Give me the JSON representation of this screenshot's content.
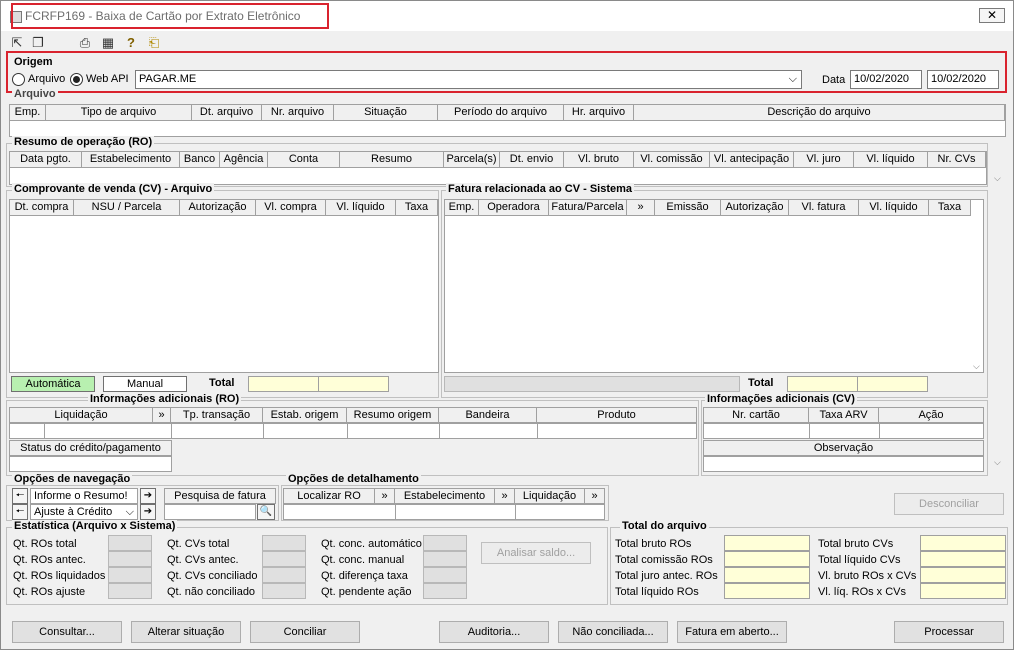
{
  "window": {
    "title": "FCRFP169 - Baixa de Cartão por Extrato Eletrônico",
    "close_label": "✕"
  },
  "toolbar": {
    "icons": [
      "arrow-in-icon",
      "windows-icon",
      "print-icon",
      "calendar-icon",
      "help-icon",
      "exit-icon"
    ]
  },
  "origem": {
    "label": "Origem",
    "opt1": "Arquivo",
    "opt2": "Web API",
    "selected": "Web API",
    "provider": "PAGAR.ME",
    "data_label": "Data",
    "date_from": "10/02/2020",
    "date_to": "10/02/2020"
  },
  "arquivo": {
    "label": "Arquivo",
    "cols": [
      "Emp.",
      "Tipo de arquivo",
      "Dt. arquivo",
      "Nr. arquivo",
      "Situação",
      "Período do arquivo",
      "Hr. arquivo",
      "Descrição do arquivo"
    ]
  },
  "ro": {
    "label": "Resumo de operação (RO)",
    "cols": [
      "Data pgto.",
      "Estabelecimento",
      "Banco",
      "Agência",
      "Conta",
      "Resumo",
      "Parcela(s)",
      "Dt. envio",
      "Vl. bruto",
      "Vl. comissão",
      "Vl. antecipação",
      "Vl. juro",
      "Vl. líquido",
      "Nr. CVs"
    ]
  },
  "cv": {
    "label": "Comprovante de venda (CV) - Arquivo",
    "cols": [
      "Dt. compra",
      "NSU / Parcela",
      "Autorização",
      "Vl. compra",
      "Vl. líquido",
      "Taxa"
    ],
    "auto_label": "Automática",
    "manual_label": "Manual",
    "total_label": "Total"
  },
  "fatura": {
    "label": "Fatura relacionada ao CV - Sistema",
    "cols": [
      "Emp.",
      "Operadora",
      "Fatura/Parcela",
      "»",
      "Emissão",
      "Autorização",
      "Vl. fatura",
      "Vl. líquido",
      "Taxa"
    ],
    "total_label": "Total"
  },
  "info_ro": {
    "label": "Informações adicionais (RO)",
    "cols": [
      "Liquidação",
      "»",
      "Tp. transação",
      "Estab. origem",
      "Resumo origem",
      "Bandeira",
      "Produto"
    ],
    "status_label": "Status do crédito/pagamento"
  },
  "info_cv": {
    "label": "Informações adicionais (CV)",
    "cols": [
      "Nr. cartão",
      "Taxa ARV",
      "Ação"
    ],
    "obs_label": "Observação"
  },
  "nav": {
    "label": "Opções de navegação",
    "item1": "Informe o Resumo!",
    "item2": "Ajuste à Crédito",
    "search_label": "Pesquisa de fatura"
  },
  "det": {
    "label": "Opções de detalhamento",
    "b1": "Localizar RO",
    "b2": "Estabelecimento",
    "b3": "Liquidação",
    "arrow": "»"
  },
  "desconciliar": "Desconciliar",
  "stats": {
    "label": "Estatística (Arquivo x Sistema)",
    "c1": [
      "Qt. ROs total",
      "Qt. ROs antec.",
      "Qt. ROs liquidados",
      "Qt. ROs ajuste"
    ],
    "c2": [
      "Qt. CVs total",
      "Qt. CVs antec.",
      "Qt. CVs conciliado",
      "Qt. não conciliado"
    ],
    "c3": [
      "Qt. conc. automático",
      "Qt. conc. manual",
      "Qt. diferença taxa",
      "Qt. pendente ação"
    ],
    "analisar": "Analisar saldo..."
  },
  "totals": {
    "label": "Total do arquivo",
    "c1": [
      "Total bruto ROs",
      "Total comissão ROs",
      "Total juro antec. ROs",
      "Total líquido ROs"
    ],
    "c2": [
      "Total bruto CVs",
      "Total líquido CVs",
      "Vl. bruto ROs x CVs",
      "Vl. líq. ROs x CVs"
    ]
  },
  "bottom": {
    "consultar": "Consultar...",
    "alterar": "Alterar situação",
    "conciliar": "Conciliar",
    "auditoria": "Auditoria...",
    "nao_conciliada": "Não conciliada...",
    "fatura_aberto": "Fatura em aberto...",
    "processar": "Processar"
  },
  "colors": {
    "accent_red": "#d9232e",
    "green": "#b8f0b0",
    "yellow": "#ffffd8"
  }
}
